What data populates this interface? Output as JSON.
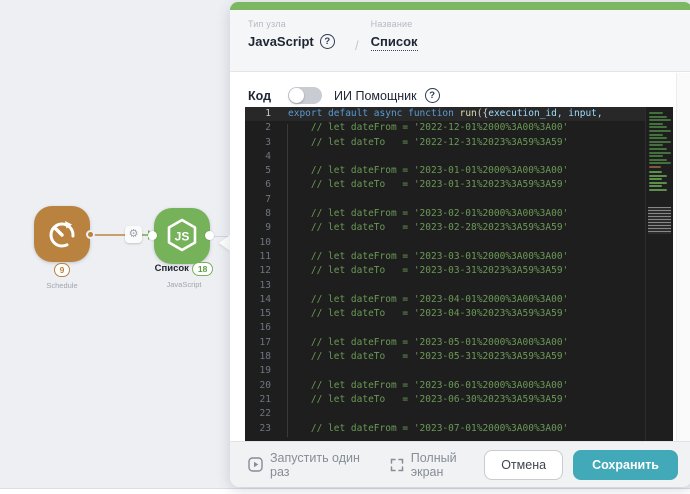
{
  "colors": {
    "canvas_bg": "#edeff3",
    "panel_accent_green": "#7cb761",
    "node_js_green": "#76b25a",
    "node_schedule_orange": "#b9823f",
    "save_button_teal": "#41a9b8",
    "editor_bg": "#1e1e1e",
    "comment_green": "#6a9955",
    "keyword_blue": "#569cd6"
  },
  "canvas": {
    "schedule_node": {
      "badge": "9",
      "caption": "Schedule"
    },
    "js_node": {
      "title": "Список",
      "badge": "18",
      "caption": "JavaScript"
    }
  },
  "panel": {
    "header": {
      "type_label": "Тип узла",
      "type_value": "JavaScript",
      "separator": "/",
      "name_label": "Название",
      "name_value": "Список",
      "help_icon": "?"
    },
    "toolbar": {
      "code_label": "Код",
      "ai_assistant_label": "ИИ Помощник",
      "ai_toggle_state": "off",
      "help_icon": "?"
    },
    "editor": {
      "language": "javascript",
      "lines": [
        {
          "n": "1",
          "active": true,
          "segments": [
            {
              "c": "kw",
              "t": "export default async function "
            },
            {
              "c": "fn",
              "t": "run"
            },
            {
              "c": "pn",
              "t": "({"
            },
            {
              "c": "pm",
              "t": "execution_id, input,"
            }
          ]
        },
        {
          "n": "2",
          "t": "    // let dateFrom = '2022-12-01%2000%3A00%3A00'"
        },
        {
          "n": "3",
          "t": "    // let dateTo   = '2022-12-31%2023%3A59%3A59'"
        },
        {
          "n": "4",
          "t": ""
        },
        {
          "n": "5",
          "t": "    // let dateFrom = '2023-01-01%2000%3A00%3A00'"
        },
        {
          "n": "6",
          "t": "    // let dateTo   = '2023-01-31%2023%3A59%3A59'"
        },
        {
          "n": "7",
          "t": ""
        },
        {
          "n": "8",
          "t": "    // let dateFrom = '2023-02-01%2000%3A00%3A00'"
        },
        {
          "n": "9",
          "t": "    // let dateTo   = '2023-02-28%2023%3A59%3A59'"
        },
        {
          "n": "10",
          "t": ""
        },
        {
          "n": "11",
          "t": "    // let dateFrom = '2023-03-01%2000%3A00%3A00'"
        },
        {
          "n": "12",
          "t": "    // let dateTo   = '2023-03-31%2023%3A59%3A59'"
        },
        {
          "n": "13",
          "t": ""
        },
        {
          "n": "14",
          "t": "    // let dateFrom = '2023-04-01%2000%3A00%3A00'"
        },
        {
          "n": "15",
          "t": "    // let dateTo   = '2023-04-30%2023%3A59%3A59'"
        },
        {
          "n": "16",
          "t": ""
        },
        {
          "n": "17",
          "t": "    // let dateFrom = '2023-05-01%2000%3A00%3A00'"
        },
        {
          "n": "18",
          "t": "    // let dateTo   = '2023-05-31%2023%3A59%3A59'"
        },
        {
          "n": "19",
          "t": ""
        },
        {
          "n": "20",
          "t": "    // let dateFrom = '2023-06-01%2000%3A00%3A00'"
        },
        {
          "n": "21",
          "t": "    // let dateTo   = '2023-06-30%2023%3A59%3A59'"
        },
        {
          "n": "22",
          "t": ""
        },
        {
          "n": "23",
          "t": "    // let dateFrom = '2023-07-01%2000%3A00%3A00'"
        }
      ]
    },
    "footer": {
      "run_once_label": "Запустить один раз",
      "fullscreen_label": "Полный экран",
      "cancel_label": "Отмена",
      "save_label": "Сохранить"
    }
  }
}
